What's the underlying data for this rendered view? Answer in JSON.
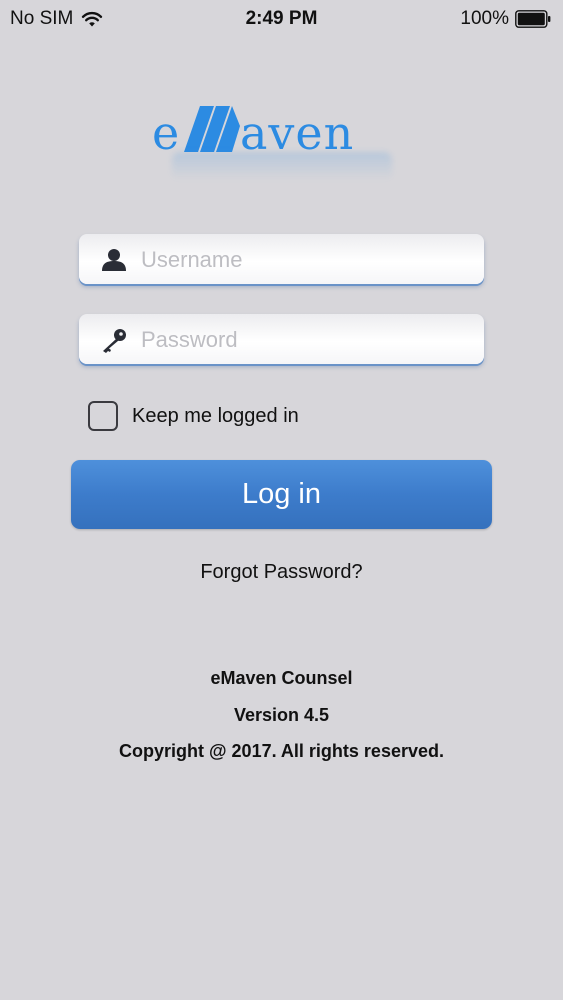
{
  "status_bar": {
    "carrier": "No SIM",
    "time": "2:49 PM",
    "battery_percent": "100%",
    "wifi_icon": "wifi-icon",
    "battery_icon": "battery-icon"
  },
  "logo": {
    "text_prefix": "e",
    "text_suffix": "aven",
    "color": "#2c8be2"
  },
  "login_form": {
    "username": {
      "placeholder": "Username",
      "value": "",
      "icon": "user-icon"
    },
    "password": {
      "placeholder": "Password",
      "value": "",
      "icon": "key-icon"
    },
    "keep_logged_in": {
      "label": "Keep me logged in",
      "checked": false
    },
    "login_button_label": "Log in",
    "forgot_password_label": "Forgot Password?"
  },
  "footer": {
    "app_name": "eMaven Counsel",
    "version": "Version 4.5",
    "copyright": "Copyright @ 2017. All rights reserved."
  },
  "colors": {
    "background": "#d7d6da",
    "accent": "#3d7ccb"
  }
}
